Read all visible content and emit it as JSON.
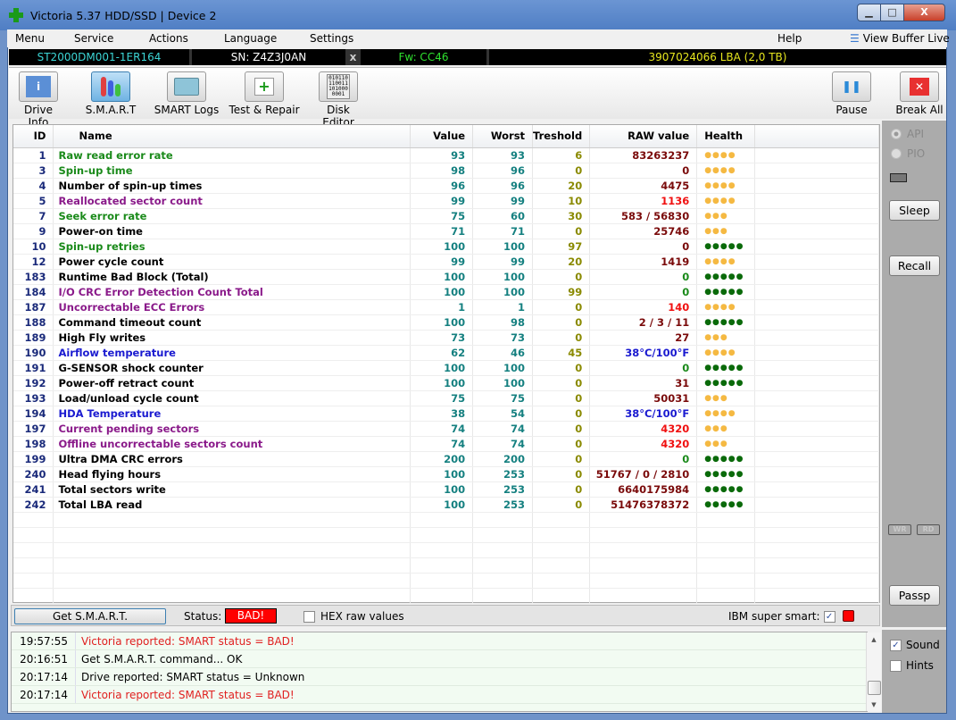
{
  "window": {
    "title": "Victoria 5.37 HDD/SSD | Device 2",
    "minimize": "▁",
    "maximize": "□",
    "close": "X"
  },
  "menu": {
    "items": [
      "Menu",
      "Service",
      "Actions",
      "Language",
      "Settings"
    ],
    "help": "Help",
    "view_buffer": "View Buffer Live"
  },
  "drive": {
    "model": "ST2000DM001-1ER164",
    "serial": "SN: Z4Z3J0AN",
    "close": "x",
    "firmware": "Fw: CC46",
    "capacity": "3907024066 LBA (2,0 TB)"
  },
  "toolbar": {
    "drive_info": "Drive Info",
    "smart": "S.M.A.R.T",
    "smart_logs": "SMART Logs",
    "test_repair": "Test & Repair",
    "disk_editor": "Disk Editor",
    "pause": "Pause",
    "break_all": "Break All",
    "disk_editor_bits": "010110\n110011\n101000\n0001"
  },
  "table": {
    "headers": {
      "id": "ID",
      "name": "Name",
      "value": "Value",
      "worst": "Worst",
      "threshold": "Treshold",
      "raw": "RAW value",
      "health": "Health"
    },
    "rows": [
      {
        "id": "1",
        "name": "Raw read error rate",
        "nc": "green",
        "value": "93",
        "worst": "93",
        "threshold": "6",
        "raw": "83263237",
        "rc": "darkred",
        "health": 4
      },
      {
        "id": "3",
        "name": "Spin-up time",
        "nc": "green",
        "value": "98",
        "worst": "96",
        "threshold": "0",
        "raw": "0",
        "rc": "darkred",
        "health": 4
      },
      {
        "id": "4",
        "name": "Number of spin-up times",
        "nc": "black",
        "value": "96",
        "worst": "96",
        "threshold": "20",
        "raw": "4475",
        "rc": "darkred",
        "health": 4
      },
      {
        "id": "5",
        "name": "Reallocated sector count",
        "nc": "purple",
        "value": "99",
        "worst": "99",
        "threshold": "10",
        "raw": "1136",
        "rc": "red",
        "health": 4
      },
      {
        "id": "7",
        "name": "Seek error rate",
        "nc": "green",
        "value": "75",
        "worst": "60",
        "threshold": "30",
        "raw": "583 / 56830",
        "rc": "darkred",
        "health": 3
      },
      {
        "id": "9",
        "name": "Power-on time",
        "nc": "black",
        "value": "71",
        "worst": "71",
        "threshold": "0",
        "raw": "25746",
        "rc": "darkred",
        "health": 3
      },
      {
        "id": "10",
        "name": "Spin-up retries",
        "nc": "green",
        "value": "100",
        "worst": "100",
        "threshold": "97",
        "raw": "0",
        "rc": "darkred",
        "health": 5
      },
      {
        "id": "12",
        "name": "Power cycle count",
        "nc": "black",
        "value": "99",
        "worst": "99",
        "threshold": "20",
        "raw": "1419",
        "rc": "darkred",
        "health": 4
      },
      {
        "id": "183",
        "name": "Runtime Bad Block (Total)",
        "nc": "black",
        "value": "100",
        "worst": "100",
        "threshold": "0",
        "raw": "0",
        "rc": "green",
        "health": 5
      },
      {
        "id": "184",
        "name": "I/O CRC Error Detection Count Total",
        "nc": "purple",
        "value": "100",
        "worst": "100",
        "threshold": "99",
        "raw": "0",
        "rc": "green",
        "health": 5
      },
      {
        "id": "187",
        "name": "Uncorrectable ECC Errors",
        "nc": "purple",
        "value": "1",
        "worst": "1",
        "threshold": "0",
        "raw": "140",
        "rc": "red",
        "health": 4
      },
      {
        "id": "188",
        "name": "Command timeout count",
        "nc": "black",
        "value": "100",
        "worst": "98",
        "threshold": "0",
        "raw": "2 / 3 / 11",
        "rc": "darkred",
        "health": 5
      },
      {
        "id": "189",
        "name": "High Fly writes",
        "nc": "black",
        "value": "73",
        "worst": "73",
        "threshold": "0",
        "raw": "27",
        "rc": "darkred",
        "health": 3
      },
      {
        "id": "190",
        "name": "Airflow temperature",
        "nc": "blue",
        "value": "62",
        "worst": "46",
        "threshold": "45",
        "raw": "38°C/100°F",
        "rc": "blue",
        "health": 4
      },
      {
        "id": "191",
        "name": "G-SENSOR shock counter",
        "nc": "black",
        "value": "100",
        "worst": "100",
        "threshold": "0",
        "raw": "0",
        "rc": "green",
        "health": 5
      },
      {
        "id": "192",
        "name": "Power-off retract count",
        "nc": "black",
        "value": "100",
        "worst": "100",
        "threshold": "0",
        "raw": "31",
        "rc": "darkred",
        "health": 5
      },
      {
        "id": "193",
        "name": "Load/unload cycle count",
        "nc": "black",
        "value": "75",
        "worst": "75",
        "threshold": "0",
        "raw": "50031",
        "rc": "darkred",
        "health": 3
      },
      {
        "id": "194",
        "name": "HDA Temperature",
        "nc": "blue",
        "value": "38",
        "worst": "54",
        "threshold": "0",
        "raw": "38°C/100°F",
        "rc": "blue",
        "health": 4
      },
      {
        "id": "197",
        "name": "Current pending sectors",
        "nc": "purple",
        "value": "74",
        "worst": "74",
        "threshold": "0",
        "raw": "4320",
        "rc": "red",
        "health": 3
      },
      {
        "id": "198",
        "name": "Offline uncorrectable sectors count",
        "nc": "purple",
        "value": "74",
        "worst": "74",
        "threshold": "0",
        "raw": "4320",
        "rc": "red",
        "health": 3
      },
      {
        "id": "199",
        "name": "Ultra DMA CRC errors",
        "nc": "black",
        "value": "200",
        "worst": "200",
        "threshold": "0",
        "raw": "0",
        "rc": "green",
        "health": 5
      },
      {
        "id": "240",
        "name": "Head flying hours",
        "nc": "black",
        "value": "100",
        "worst": "253",
        "threshold": "0",
        "raw": "51767 / 0 / 2810",
        "rc": "darkred",
        "health": 5
      },
      {
        "id": "241",
        "name": "Total sectors write",
        "nc": "black",
        "value": "100",
        "worst": "253",
        "threshold": "0",
        "raw": "6640175984",
        "rc": "darkred",
        "health": 5
      },
      {
        "id": "242",
        "name": "Total LBA read",
        "nc": "black",
        "value": "100",
        "worst": "253",
        "threshold": "0",
        "raw": "51476378372",
        "rc": "darkred",
        "health": 5
      }
    ]
  },
  "colors": {
    "green": "#1a8a1a",
    "black": "#000000",
    "purple": "#8a1a8a",
    "blue": "#1a1ad0",
    "darkred": "#7a0a0a",
    "red": "#f01010",
    "health_warn": "#f5b942",
    "health_good": "#0a6a0a",
    "status_bad": "#ff0000"
  },
  "side": {
    "api": "API",
    "pio": "PIO",
    "sleep": "Sleep",
    "recall": "Recall",
    "wr": "WR",
    "rd": "RD",
    "passp": "Passp",
    "sound": "Sound",
    "hints": "Hints",
    "sound_checked": true,
    "hints_checked": false,
    "api_selected": true
  },
  "status": {
    "get_smart": "Get S.M.A.R.T.",
    "label": "Status:",
    "value": "BAD!",
    "hex_label": "HEX raw values",
    "hex_checked": false,
    "ibm_label": "IBM super smart:",
    "ibm_checked": true
  },
  "log": [
    {
      "time": "19:57:55",
      "msg": "Victoria reported: SMART status = BAD!",
      "error": true
    },
    {
      "time": "20:16:51",
      "msg": "Get S.M.A.R.T. command... OK",
      "error": false
    },
    {
      "time": "20:17:14",
      "msg": "Drive reported: SMART status = Unknown",
      "error": false
    },
    {
      "time": "20:17:14",
      "msg": "Victoria reported: SMART status = BAD!",
      "error": true
    }
  ]
}
